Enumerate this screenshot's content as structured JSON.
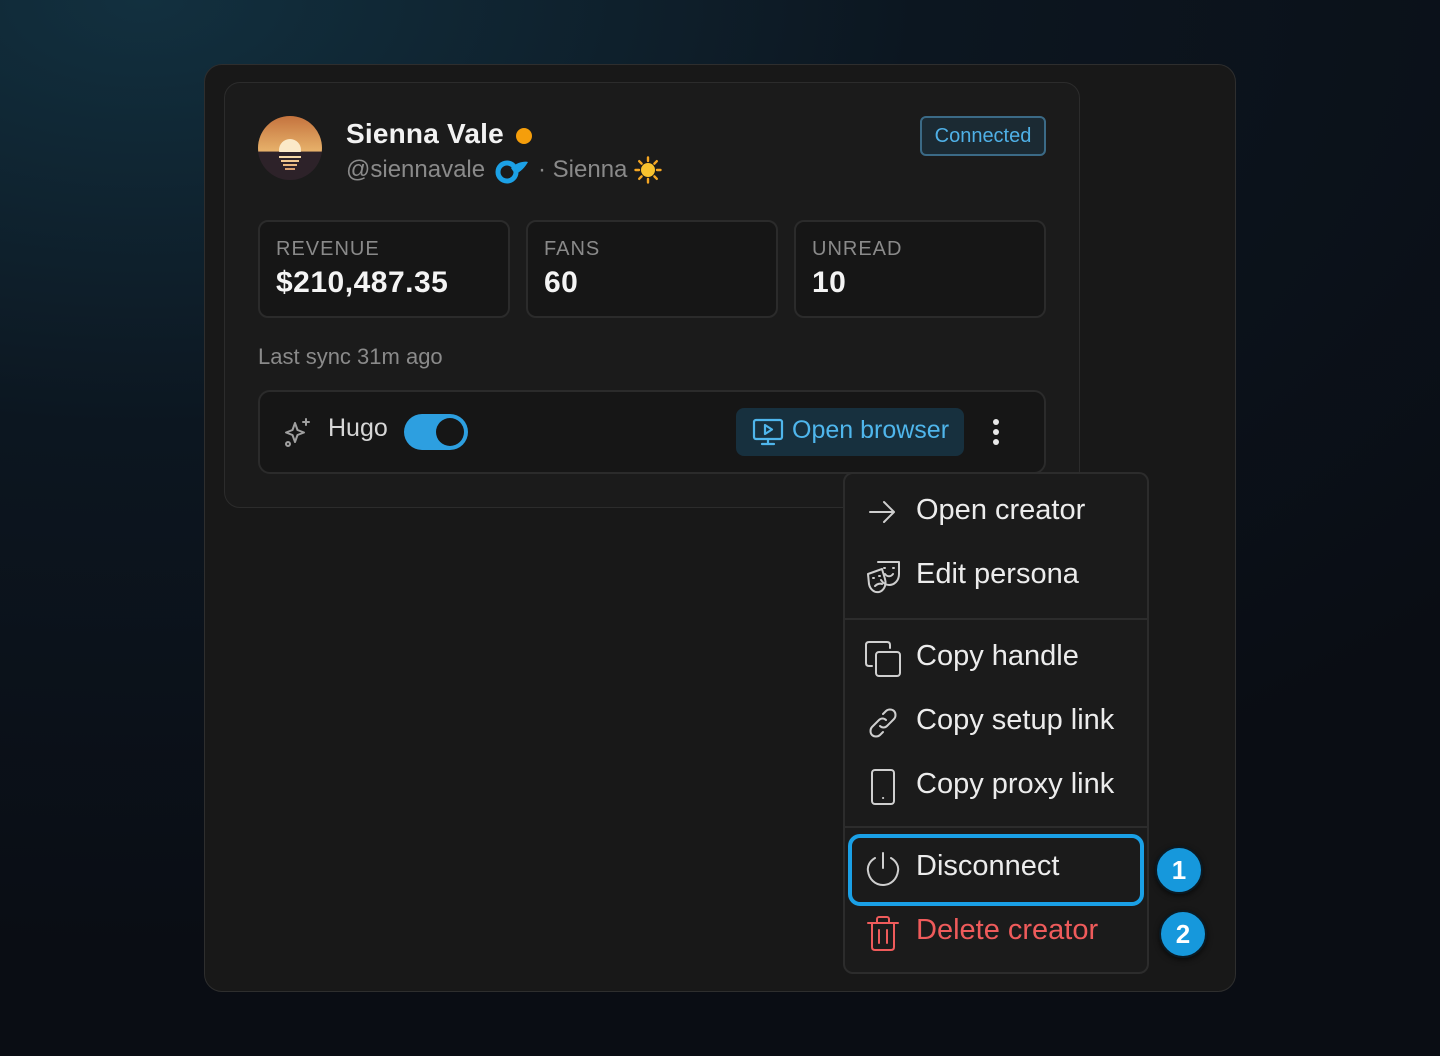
{
  "creator": {
    "name": "Sienna Vale",
    "handle": "@siennavale",
    "persona": "· Sienna",
    "status_color": "#f59e0b",
    "platform_icon": "onlyfans-icon",
    "persona_icon": "sun-icon",
    "connection_badge": "Connected"
  },
  "stats": [
    {
      "label": "REVENUE",
      "value": "$210,487.35"
    },
    {
      "label": "FANS",
      "value": "60"
    },
    {
      "label": "UNREAD",
      "value": "10"
    }
  ],
  "sync": {
    "text": "Last sync 31m ago"
  },
  "toolbar": {
    "agent_name": "Hugo",
    "agent_enabled": true,
    "open_browser_label": "Open browser"
  },
  "menu": {
    "items": [
      {
        "label": "Open creator",
        "icon": "arrow-right-icon"
      },
      {
        "label": "Edit persona",
        "icon": "theater-masks-icon"
      },
      {
        "label": "Copy handle",
        "icon": "copy-icon"
      },
      {
        "label": "Copy setup link",
        "icon": "link-icon"
      },
      {
        "label": "Copy proxy link",
        "icon": "phone-icon"
      },
      {
        "label": "Disconnect",
        "icon": "power-icon"
      },
      {
        "label": "Delete creator",
        "icon": "trash-icon"
      }
    ]
  },
  "markers": [
    "1",
    "2"
  ],
  "colors": {
    "accent": "#1aa0e6",
    "danger": "#ef5b5b",
    "status_online": "#f59e0b"
  }
}
